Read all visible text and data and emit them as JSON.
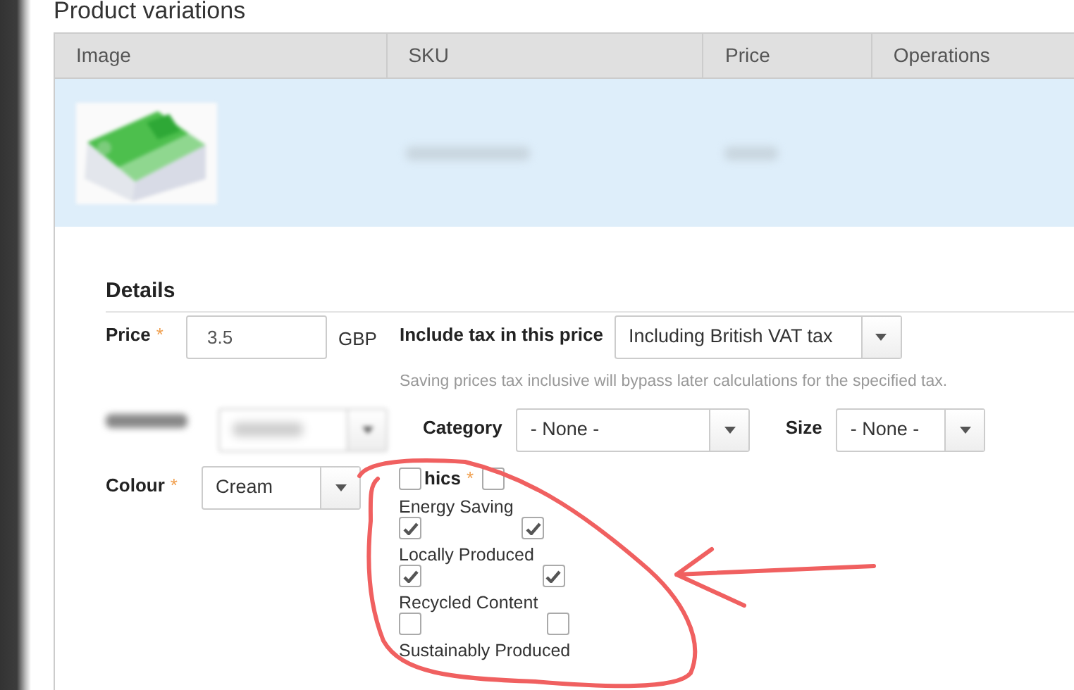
{
  "section_title": "Product variations",
  "table": {
    "columns": [
      "Image",
      "SKU",
      "Price",
      "Operations"
    ],
    "rows": [
      {
        "selected": true
      }
    ]
  },
  "details": {
    "title": "Details",
    "price": {
      "label": "Price",
      "required_mark": "*",
      "value": "3.5",
      "currency": "GBP"
    },
    "tax": {
      "label": "Include tax in this price",
      "value": "Including British VAT tax",
      "help": "Saving prices tax inclusive will bypass later calculations for the specified tax."
    },
    "category": {
      "label": "Category",
      "value": "- None -"
    },
    "size": {
      "label": "Size",
      "value": "- None -"
    },
    "colour": {
      "label": "Colour",
      "required_mark": "*",
      "value": "Cream"
    },
    "ethics": {
      "label": "hics",
      "required_mark": "*",
      "checks": [
        false,
        false
      ],
      "options": [
        {
          "label": "Energy Saving",
          "checks": [
            true,
            true
          ]
        },
        {
          "label": "Locally Produced",
          "checks": [
            true,
            true
          ]
        },
        {
          "label": "Recycled Content",
          "checks": [
            false,
            false
          ]
        },
        {
          "label": "Sustainably Produced"
        }
      ]
    }
  }
}
